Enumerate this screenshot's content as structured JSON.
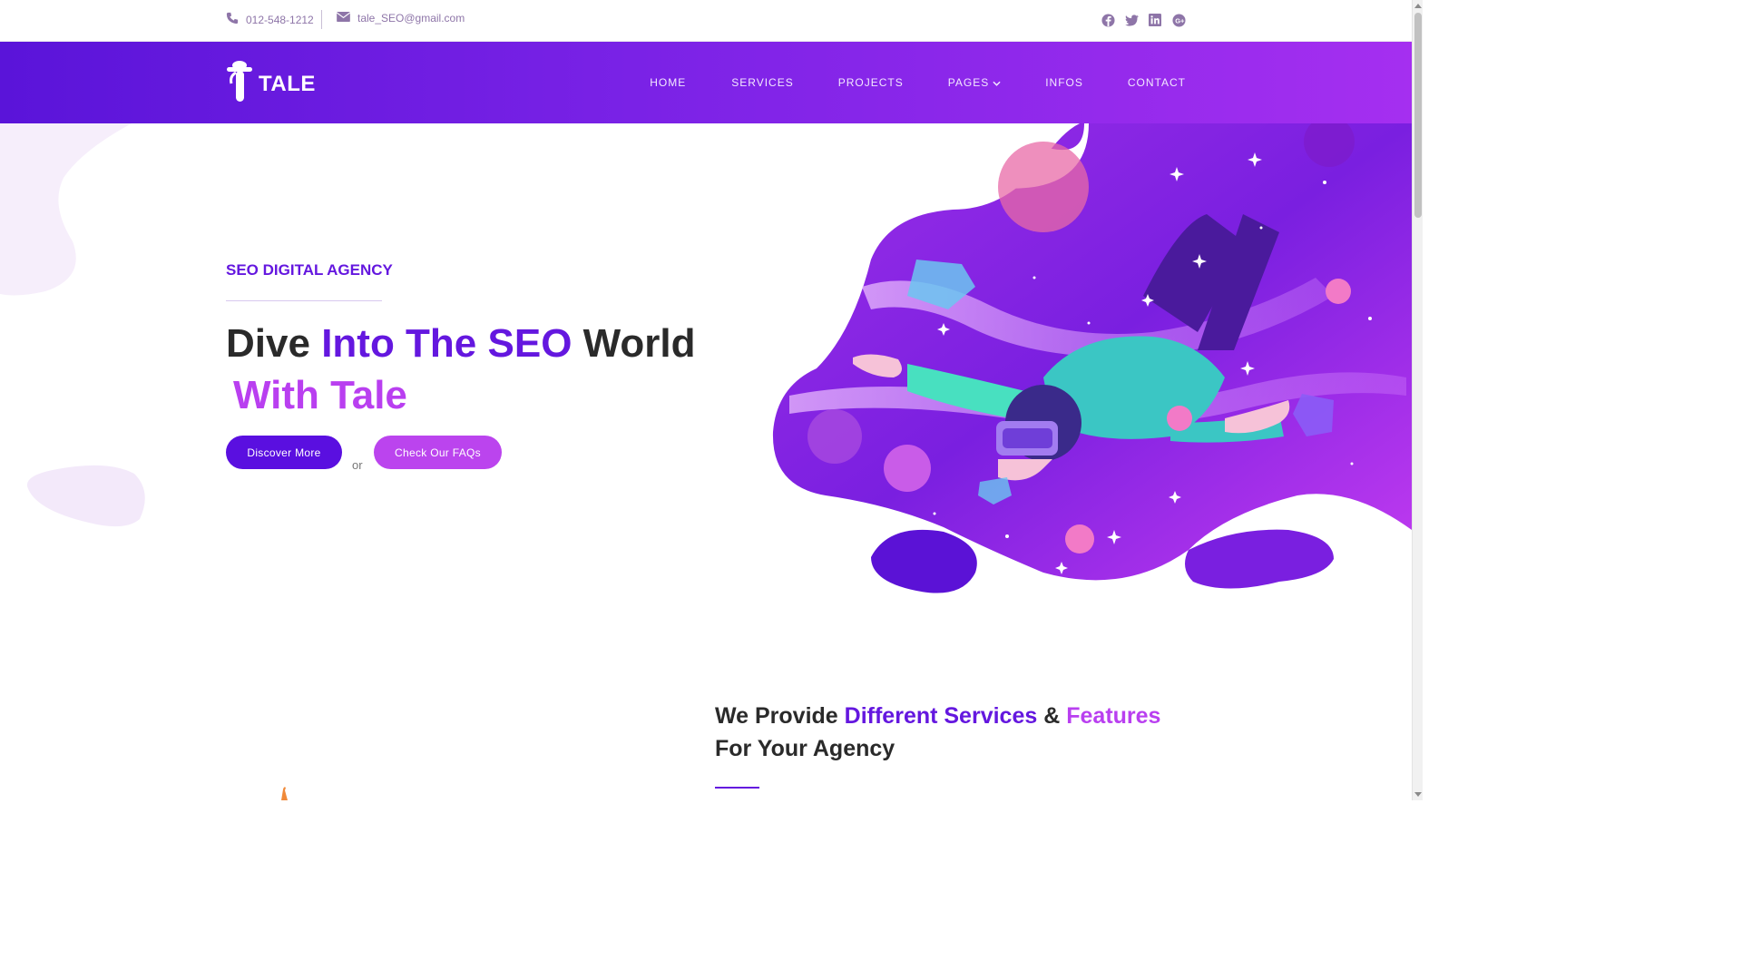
{
  "topbar": {
    "phone": "012-548-1212",
    "email": "tale_SEO@gmail.com",
    "icons": [
      "phone-icon",
      "envelope-icon",
      "facebook-icon",
      "twitter-icon",
      "linkedin-icon",
      "google-plus-icon"
    ]
  },
  "header": {
    "logo_text": "TALE",
    "nav": {
      "home": "HOME",
      "services": "SERVICES",
      "projects": "PROJECTS",
      "pages": "PAGES",
      "infos": "INFOS",
      "contact": "CONTACT"
    }
  },
  "hero": {
    "kicker": "SEO DIGITAL AGENCY",
    "title_part1": "Dive",
    "title_part2": "Into The SEO",
    "title_part3": "World",
    "title_part4": "With Tale",
    "primary_button": "Discover More",
    "or_text": "or",
    "secondary_button": "Check Our FAQs"
  },
  "services": {
    "title_part1": "We Provide",
    "title_part2": "Different Services",
    "title_part3": "&",
    "title_part4": "Features",
    "title_part5": "For Your Agency"
  },
  "colors": {
    "brand_dark": "#5a14d9",
    "brand_light": "#a52ff0",
    "accent_pink": "#bb44ee",
    "text_dark": "#2a2a2a"
  }
}
